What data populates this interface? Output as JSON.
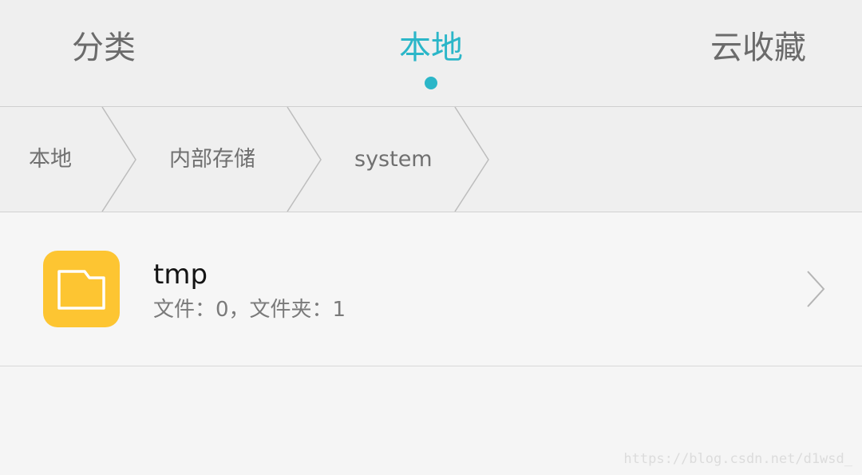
{
  "tabs": {
    "left": "分类",
    "center": "本地",
    "right": "云收藏",
    "active": "center"
  },
  "breadcrumb": [
    "本地",
    "内部存储",
    "system"
  ],
  "files": [
    {
      "name": "tmp",
      "meta": "文件：0，文件夹：1",
      "icon": "folder-icon"
    }
  ],
  "watermark": "https://blog.csdn.net/d1wsd_",
  "colors": {
    "accent": "#2bb6c8",
    "folder": "#fdc532"
  }
}
